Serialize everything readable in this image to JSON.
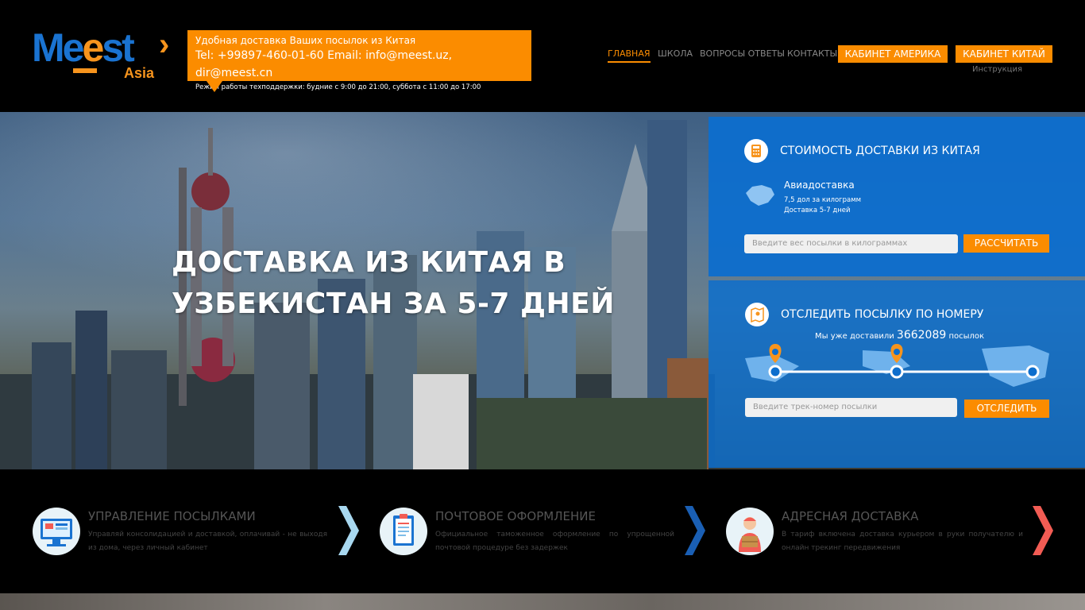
{
  "header": {
    "logo": {
      "main": "Meest",
      "sub": "Asia"
    },
    "info": {
      "line1": "Удобная доставка Ваших посылок из Китая",
      "line2": "Tel: +99897-460-01-60 Email: info@meest.uz, dir@meest.cn",
      "line3": "Режим работы техподдержки: будние с 9:00 до 21:00, суббота с 11:00 до 17:00"
    },
    "nav": [
      "ГЛАВНАЯ",
      "ШКОЛА",
      "ВОПРОСЫ ОТВЕТЫ",
      "КОНТАКТЫ"
    ],
    "cabinet_america": "КАБИНЕТ АМЕРИКА",
    "cabinet_china": "КАБИНЕТ КИТАЙ",
    "instruction": "Инструкция",
    "accent": "#fb8c00"
  },
  "hero": {
    "title": "ДОСТАВКА ИЗ КИТАЯ В УЗБЕКИСТАН ЗА 5-7 ДНЕЙ"
  },
  "calc": {
    "title": "СТОИМОСТЬ ДОСТАВКИ ИЗ КИТАЯ",
    "icon": "calculator-icon",
    "method": "Авиадоставка",
    "rate": "7,5 дол за килограмм",
    "duration": "Доставка 5-7 дней",
    "placeholder": "Введите вес посылки в килограммах",
    "button": "РАССЧИТАТЬ"
  },
  "track": {
    "title": "ОТСЛЕДИТЬ ПОСЫЛКУ ПО НОМЕРУ",
    "icon": "map-icon",
    "delivered_prefix": "Мы уже доставили",
    "delivered_count": "3662089",
    "delivered_suffix": "посылок",
    "placeholder": "Введите трек-номер посылки",
    "button": "ОТСЛЕДИТЬ"
  },
  "features": [
    {
      "title": "УПРАВЛЕНИЕ ПОСЫЛКАМИ",
      "text": "Управляй консолидацией и доставкой, оплачивай - не выходя из дома, через личный кабинет",
      "icon": "monitor-icon",
      "arrow_color": "#a8d8f0"
    },
    {
      "title": "ПОЧТОВОЕ ОФОРМЛЕНИЕ",
      "text": "Официальное таможенное оформление по упрощенной почтовой процедуре без задержек",
      "icon": "clipboard-icon",
      "arrow_color": "#1a5fb4"
    },
    {
      "title": "АДРЕСНАЯ ДОСТАВКА",
      "text": "В тариф включена доставка курьером в руки получателю и онлайн трекинг передвижения",
      "icon": "courier-icon",
      "arrow_color": "#f25c54"
    }
  ],
  "panel_color": "#0d6ecd"
}
